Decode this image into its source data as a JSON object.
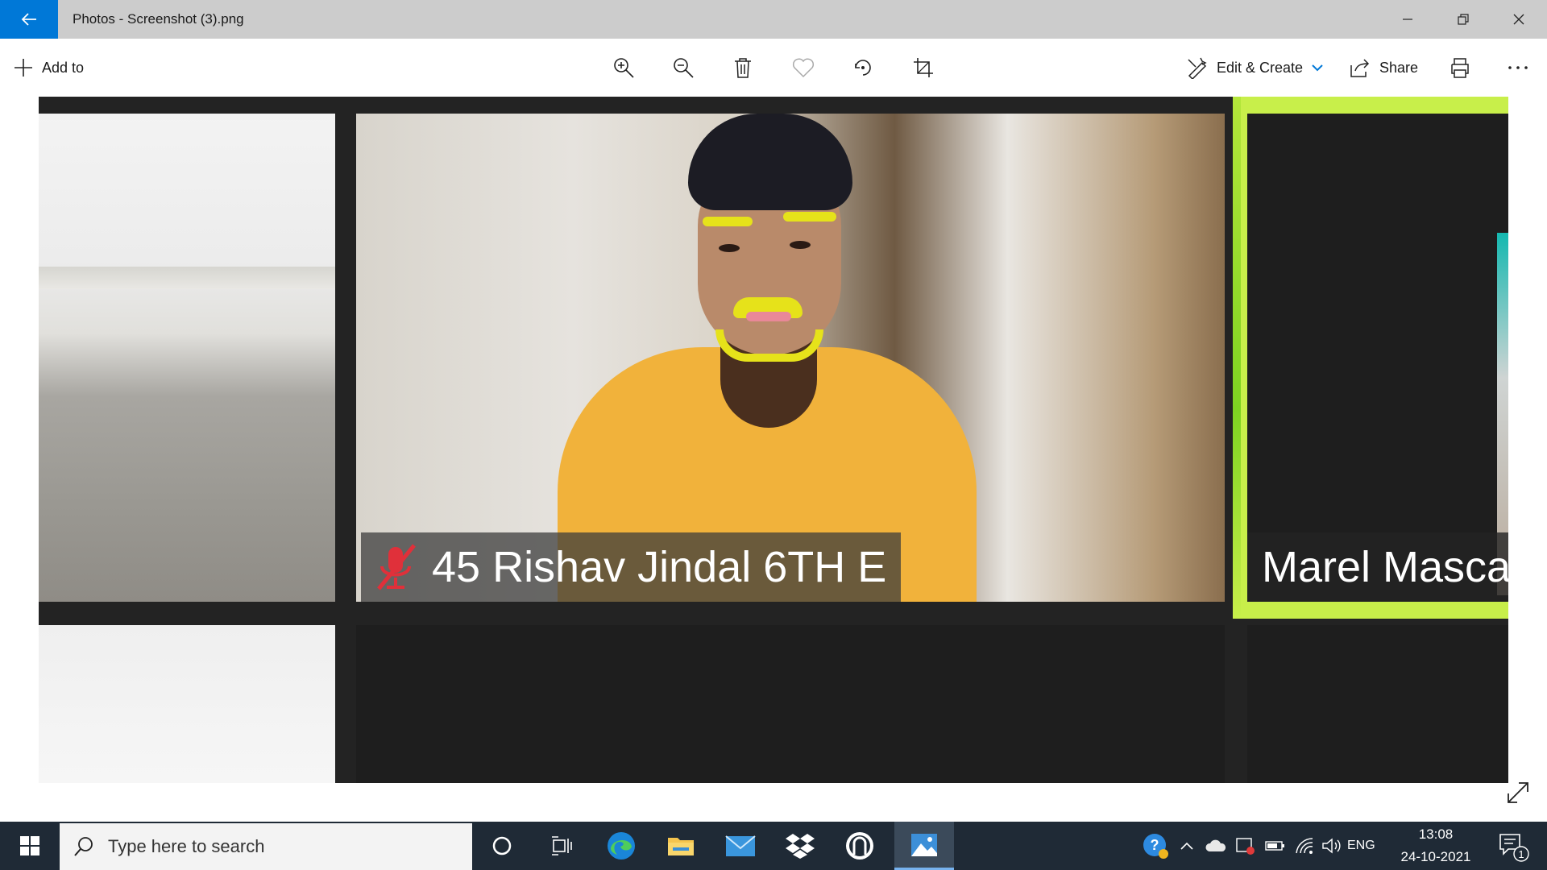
{
  "window": {
    "title": "Photos - Screenshot (3).png"
  },
  "toolbar": {
    "add_to_label": "Add to",
    "edit_create_label": "Edit & Create",
    "share_label": "Share",
    "icons": [
      "zoom-in-icon",
      "zoom-out-icon",
      "delete-icon",
      "favorite-icon",
      "rotate-icon",
      "crop-icon"
    ]
  },
  "photo": {
    "participants": [
      {
        "name": "45 Rishav Jindal 6TH E",
        "muted": true
      },
      {
        "name": "Marel Masca",
        "muted": false,
        "active_speaker": true
      }
    ],
    "colors": {
      "active_speaker_border": "#c8ef4a",
      "tile_background": "#232323"
    }
  },
  "taskbar": {
    "search_placeholder": "Type here to search",
    "language": "ENG",
    "time": "13:08",
    "date": "24-10-2021",
    "notification_count": "1",
    "pinned_apps": [
      "cortana-icon",
      "task-view-icon",
      "edge-icon",
      "file-explorer-icon",
      "mail-icon",
      "dropbox-icon",
      "steam-icon",
      "photos-icon"
    ]
  },
  "colors": {
    "accent": "#0078d7",
    "taskbar": "#1f2a36",
    "titlebar": "#cccccc"
  }
}
